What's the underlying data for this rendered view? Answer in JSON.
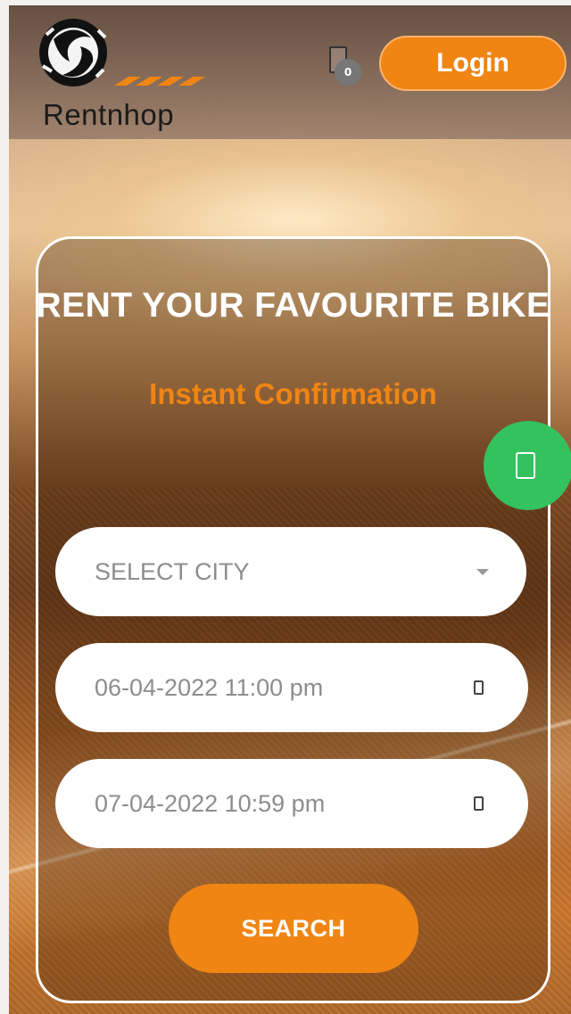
{
  "header": {
    "logo_text": "Rentnhop",
    "cart_count": "0",
    "login_label": "Login"
  },
  "hero": {
    "title": "RENT YOUR FAVOURITE BIKE",
    "subtitle": "Instant Confirmation"
  },
  "form": {
    "city_placeholder": "SELECT CITY",
    "start_datetime": "06-04-2022 11:00 pm",
    "end_datetime": "07-04-2022 10:59 pm",
    "search_label": "SEARCH"
  },
  "icons": {
    "cart": "cart-icon",
    "whatsapp": "whatsapp-icon",
    "calendar": "calendar-icon",
    "dropdown": "chevron-down-icon"
  },
  "colors": {
    "accent": "#f08513",
    "whatsapp": "#34c25f"
  }
}
